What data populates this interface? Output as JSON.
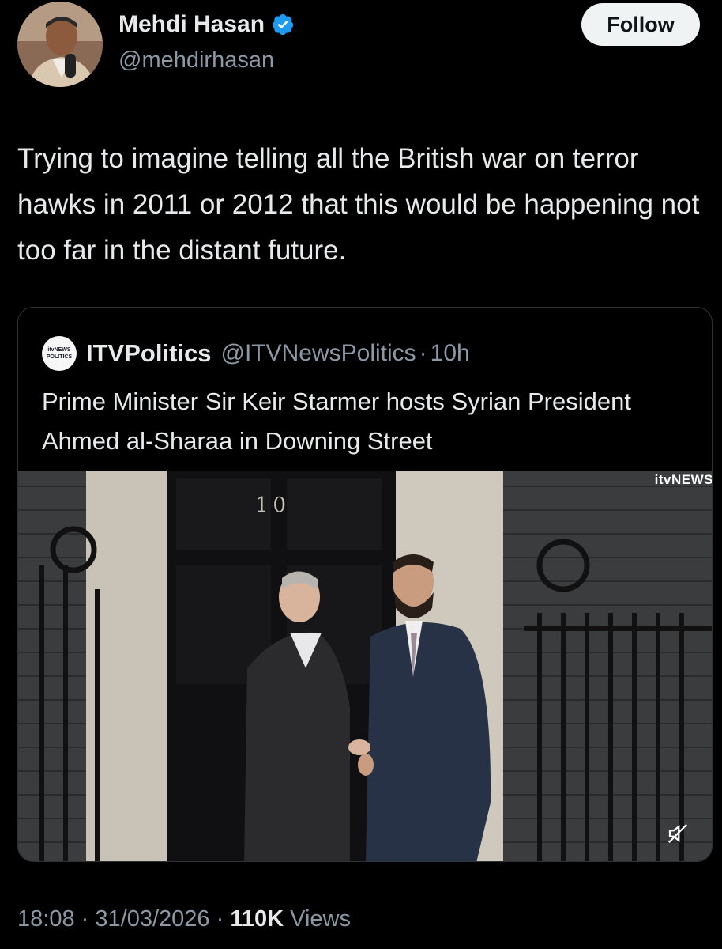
{
  "author": {
    "name": "Mehdi Hasan",
    "handle": "@mehdirhasan",
    "verified": true,
    "follow_label": "Follow"
  },
  "tweet": {
    "text": "Trying to imagine telling all the British war on terror hawks in 2011 or 2012 that this would be happening not too far in the distant future."
  },
  "quoted": {
    "avatar_text_top": "itvNEWS",
    "avatar_text_bottom": "POLITICS",
    "name": "ITVPolitics",
    "handle": "@ITVNewsPolitics",
    "separator": "·",
    "age": "10h",
    "text": "Prime Minister Sir Keir Starmer hosts Syrian President Ahmed al-Sharaa in Downing Street",
    "media": {
      "door_number": "10",
      "watermark": "itvNEWS",
      "mute_icon": "speaker-muted-icon"
    }
  },
  "meta": {
    "time": "18:08",
    "separator": "·",
    "date": "31/03/2026",
    "views_count": "110K",
    "views_label": "Views"
  },
  "colors": {
    "background": "#000000",
    "text": "#e7e9ea",
    "secondary": "#8b98a5",
    "verified": "#1d9bf0",
    "border": "#2f3336"
  }
}
